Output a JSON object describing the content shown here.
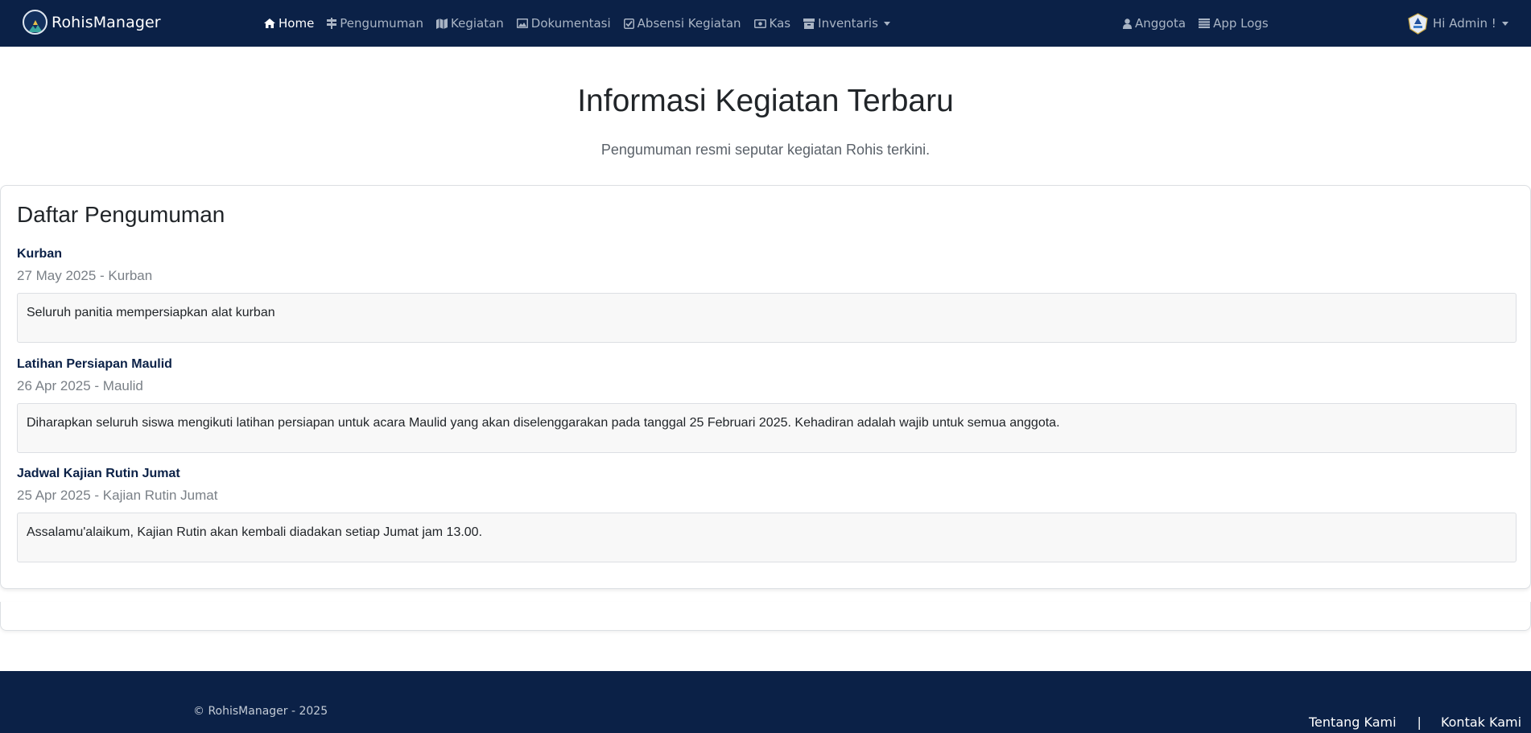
{
  "app": {
    "name": "RohisManager"
  },
  "nav": {
    "items": [
      {
        "label": "Home",
        "icon": "home-icon",
        "active": true
      },
      {
        "label": "Pengumuman",
        "icon": "signpost-icon"
      },
      {
        "label": "Kegiatan",
        "icon": "map-icon"
      },
      {
        "label": "Dokumentasi",
        "icon": "image-icon"
      },
      {
        "label": "Absensi Kegiatan",
        "icon": "check-square-icon"
      },
      {
        "label": "Kas",
        "icon": "money-icon"
      },
      {
        "label": "Inventaris",
        "icon": "archive-icon",
        "dropdown": true
      }
    ],
    "right_items": [
      {
        "label": "Anggota",
        "icon": "user-icon"
      },
      {
        "label": "App Logs",
        "icon": "list-icon"
      }
    ],
    "user_label": "Hi Admin !"
  },
  "hero": {
    "title": "Informasi Kegiatan Terbaru",
    "subtitle": "Pengumuman resmi seputar kegiatan Rohis terkini."
  },
  "announcements": {
    "heading": "Daftar Pengumuman",
    "items": [
      {
        "title": "Kurban",
        "meta": "27 May 2025 - Kurban",
        "body": "Seluruh panitia mempersiapkan alat kurban"
      },
      {
        "title": "Latihan Persiapan Maulid",
        "meta": "26 Apr 2025 - Maulid",
        "body": "Diharapkan seluruh siswa mengikuti latihan persiapan untuk acara Maulid yang akan diselenggarakan pada tanggal 25 Februari 2025. Kehadiran adalah wajib untuk semua anggota."
      },
      {
        "title": "Jadwal Kajian Rutin Jumat",
        "meta": "25 Apr 2025 - Kajian Rutin Jumat",
        "body": "Assalamu'alaikum, Kajian Rutin akan kembali diadakan setiap Jumat jam 13.00."
      }
    ]
  },
  "footer": {
    "copyright": "© RohisManager - 2025",
    "links": [
      "Tentang Kami",
      "Kontak Kami"
    ],
    "separator": "|"
  },
  "colors": {
    "navbar": "#0b2147",
    "nav_text": "#a9b4c4",
    "accent_title": "#0b2147"
  }
}
